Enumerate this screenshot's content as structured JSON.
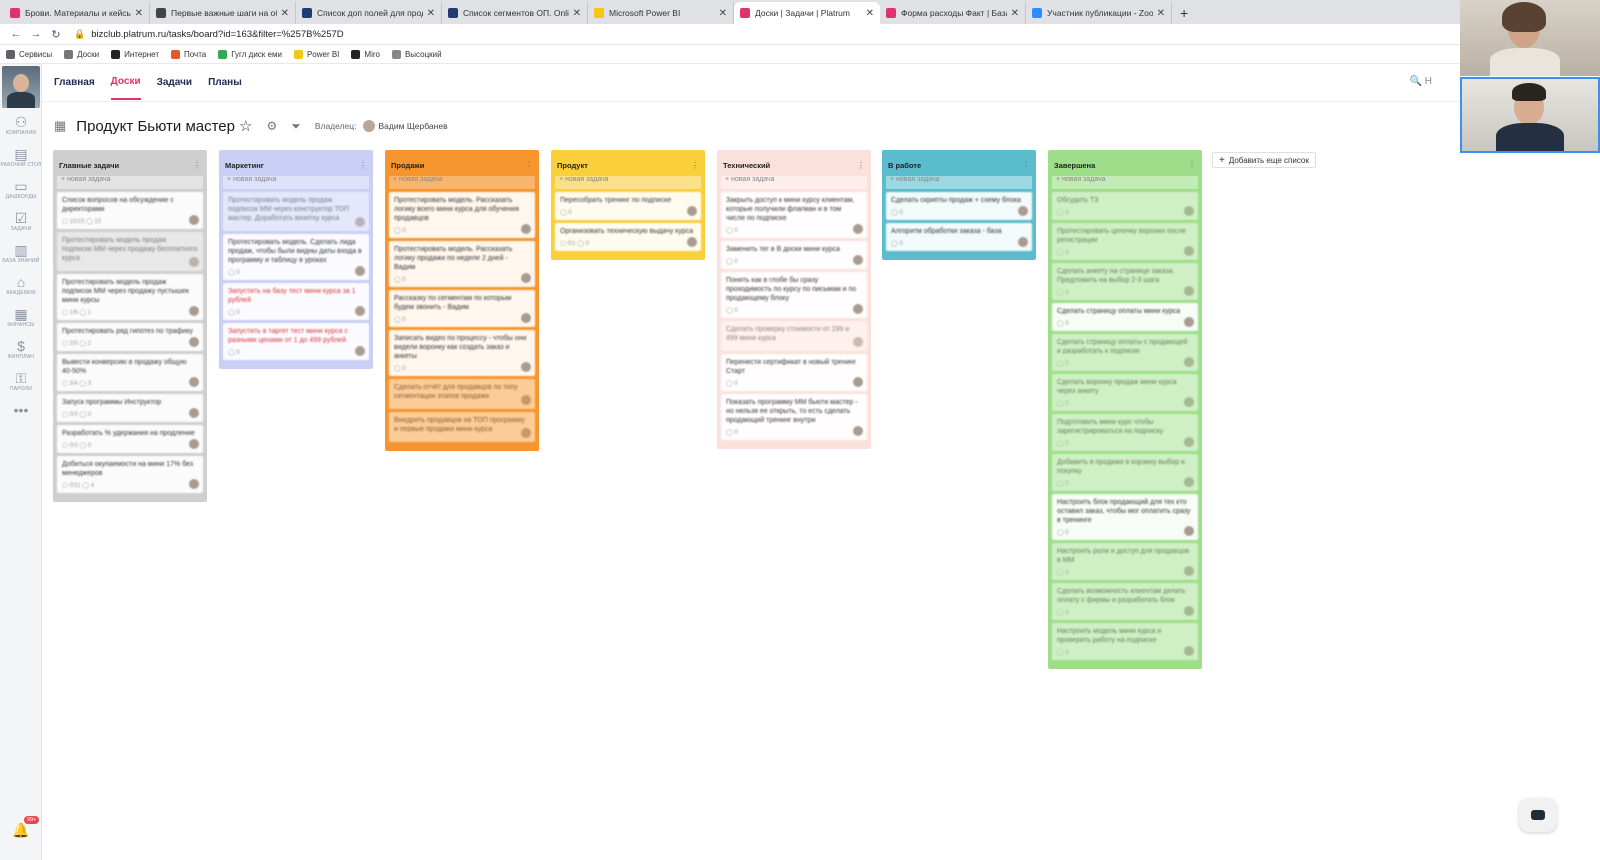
{
  "browser": {
    "tabs": [
      {
        "title": "Брови. Материалы и кейсы | ...",
        "color": "#e0336b",
        "active": false
      },
      {
        "title": "Первые важные шаги на обу...",
        "color": "#444444",
        "active": false
      },
      {
        "title": "Список доп полей для прод...",
        "color": "#1f3b70",
        "active": false
      },
      {
        "title": "Список сегментов ОП. Onlin...",
        "color": "#1f3b70",
        "active": false
      },
      {
        "title": "Microsoft Power BI",
        "color": "#f2c811",
        "active": false
      },
      {
        "title": "Доски | Задачи | Platrum",
        "color": "#e0336b",
        "active": true
      },
      {
        "title": "Форма расходы Факт | База...",
        "color": "#e0336b",
        "active": false
      },
      {
        "title": "Участник публикации - Zoom",
        "color": "#2d8cff",
        "active": false
      }
    ],
    "url": "bizclub.platrum.ru/tasks/board?id=163&filter=%257B%257D",
    "bookmarks": [
      {
        "label": "Сервисы",
        "color": "#5f6368"
      },
      {
        "label": "Доски",
        "color": "#777777"
      },
      {
        "label": "Интернет",
        "color": "#222222"
      },
      {
        "label": "Почта",
        "color": "#e8572b"
      },
      {
        "label": "Гугл диск еми",
        "color": "#34a853"
      },
      {
        "label": "Power BI",
        "color": "#f2c811"
      },
      {
        "label": "Miro",
        "color": "#222222"
      },
      {
        "label": "Высоцкий",
        "color": "#888888"
      }
    ]
  },
  "rail": {
    "items": [
      {
        "icon": "⚇",
        "label": "Компания"
      },
      {
        "icon": "▤",
        "label": "Рабочий стол"
      },
      {
        "icon": "▭",
        "label": "Дашборды"
      },
      {
        "icon": "☑",
        "label": "Задачи"
      },
      {
        "icon": "▥",
        "label": "База знаний"
      },
      {
        "icon": "⌂",
        "label": "Академия"
      },
      {
        "icon": "▦",
        "label": "Финансы"
      },
      {
        "icon": "$",
        "label": "Финплан"
      },
      {
        "icon": "⚿",
        "label": "Пароли"
      },
      {
        "icon": "•••",
        "label": ""
      }
    ],
    "notifications": "99+"
  },
  "nav": {
    "items": [
      "Главная",
      "Доски",
      "Задачи",
      "Планы"
    ],
    "active_index": 1,
    "search_hint": "Н"
  },
  "board": {
    "title": "Продукт Бьюти мастер",
    "owner_label": "Владелец:",
    "owner_name": "Вадим Щербанев",
    "add_list": "Добавить еще список",
    "new_task": "+ новая задача"
  },
  "columns": [
    {
      "title": "Главные задачи",
      "bg": "#cfcfcf",
      "newbg": "#e3e3e3",
      "cards": [
        {
          "text": "Список вопросов на обсуждение с директорами",
          "meta": "▢ 10/15  ◯ 10"
        },
        {
          "text": "Протестировать модель продаж подписки MM через продажу бесплатного курса",
          "meta": "",
          "faded": true
        },
        {
          "text": "Протестировать модель продаж подписок MM через продажу пустышек мини курсы",
          "meta": "▢ 1/6  ◯ 1"
        },
        {
          "text": "Протестировать ряд гипотез по трафику",
          "meta": "▢ 2/5  ◯ 2"
        },
        {
          "text": "Вывести конверсию в продажу общую 40-50%",
          "meta": "▢ 3/4  ◯ 3"
        },
        {
          "text": "Запуск программы Инструктор",
          "meta": "▢ 0/3  ◯ 0"
        },
        {
          "text": "Разработать % удержания на продление",
          "meta": "▢ 0/3  ◯ 0"
        },
        {
          "text": "Добиться окупаемости на мини 17% без менеджеров",
          "meta": "▢ 0/11  ◯ 4"
        }
      ]
    },
    {
      "title": "Маркетинг",
      "bg": "#c9cff5",
      "newbg": "#dde1fa",
      "cards": [
        {
          "text": "Протестировать модель продаж подписок MM через конструктор ТОП мастер. Доработать визитку курса",
          "meta": "",
          "faded": true
        },
        {
          "text": "Протестировать модель. Сделать лида продаж, чтобы были видны даты входа в программу и таблицу в уроках",
          "meta": "◯ 0"
        },
        {
          "text": "Запустить на базу тест мини курса за 1 рублей",
          "meta": "◯ 0",
          "red": true
        },
        {
          "text": "Запустить в таргет тест мини курса с разными ценами от 1 до 499 рублей",
          "meta": "◯ 0",
          "red": true
        }
      ]
    },
    {
      "title": "Продажи",
      "bg": "#f6952e",
      "newbg": "#f9b56e",
      "cards": [
        {
          "text": "Протестировать модель. Рассказать логику всего мини курса для обучения продавцов",
          "meta": "◯ 0"
        },
        {
          "text": "Протестировать модель. Рассказать логику продажи по неделе 2 дней - Вадим",
          "meta": "◯ 0"
        },
        {
          "text": "Рассказку по сегментам по которым будем звонить - Вадим",
          "meta": "◯ 0"
        },
        {
          "text": "Записать видео по процессу - чтобы они видели воронку как создать заказ и анкеты",
          "meta": "◯ 0"
        },
        {
          "text": "Сделать отчёт для продавцов по типу сегментации этапов продажи",
          "meta": "",
          "faded": true
        },
        {
          "text": "Внедрить продавцов на ТОП программу и первые продажи мини курса",
          "meta": "",
          "faded": true
        }
      ]
    },
    {
      "title": "Продукт",
      "bg": "#f9cf3a",
      "newbg": "#fbe08a",
      "cards": [
        {
          "text": "Пересобрать тренинг по подписке",
          "meta": "◯ 0"
        },
        {
          "text": "Организовать техническую выдачу курса",
          "meta": "▢ 0/1  ◯ 0"
        }
      ]
    },
    {
      "title": "Технический",
      "bg": "#fbe1dc",
      "newbg": "#fdeeeb",
      "cards": [
        {
          "text": "Закрыть доступ к мини курсу клиентам, которые получили флагман и в том числе по подписке",
          "meta": "◯ 0"
        },
        {
          "text": "Заменить тег в B доски мини курса",
          "meta": "◯ 0"
        },
        {
          "text": "Понять как в глобе бы сразу проходимость по курсу по письмам и по продающему блоку",
          "meta": "◯ 0"
        },
        {
          "text": "Сделать проверку стоимости от 299 и 499 мини курса",
          "meta": "",
          "faded": true
        },
        {
          "text": "Перенести сертификат в новый тренинг Старт",
          "meta": "◯ 0"
        },
        {
          "text": "Показать программу MM бьюти мастер - но нельзя ее открыть, то есть сделать продающий тренинг внутри",
          "meta": "◯ 0"
        }
      ]
    },
    {
      "title": "В работе",
      "bg": "#5bbccd",
      "newbg": "#9ad8e2",
      "cards": [
        {
          "text": "Сделать скрипты продаж + схему блока",
          "meta": "◯ 0"
        },
        {
          "text": "Алгоритм обработки заказа - база",
          "meta": "◯ 0"
        }
      ]
    },
    {
      "title": "Завершена",
      "bg": "#9ede8a",
      "newbg": "#c2ebb5",
      "cards": [
        {
          "text": "Обсудить ТЗ",
          "meta": "◯ 0",
          "faded": true
        },
        {
          "text": "Протестировать цепочку воронки после регистрации",
          "meta": "◯ 0",
          "faded": true
        },
        {
          "text": "Сделать анкету на странице заказа. Предложить на выбор 2-3 шага",
          "meta": "◯ 0",
          "faded": true
        },
        {
          "text": "Сделать страницу оплаты мини курса",
          "meta": "◯ 0"
        },
        {
          "text": "Сделать страницу оплаты с продающей и разработать к подписке",
          "meta": "◯ 0",
          "faded": true
        },
        {
          "text": "Сделать воронку продаж мини курса через анкету",
          "meta": "◯ 0",
          "faded": true
        },
        {
          "text": "Подготовить мини курс чтобы зарегистрироваться на подписку",
          "meta": "◯ 0",
          "faded": true
        },
        {
          "text": "Добавить в продажи в корзину выбор и покупку",
          "meta": "◯ 0",
          "faded": true
        },
        {
          "text": "Настроить блок продающий для тех кто оставил заказ, чтобы мог оплатить сразу в тренинге",
          "meta": "◯ 0"
        },
        {
          "text": "Настроить роли и доступ для продавцов в MM",
          "meta": "◯ 0",
          "faded": true
        },
        {
          "text": "Сделать возможность клиентам делать оплату с фирмы и разработать блок",
          "meta": "◯ 0",
          "faded": true
        },
        {
          "text": "Настроить модель мини курса и проверить работу на подписке",
          "meta": "◯ 0",
          "faded": true
        }
      ]
    }
  ]
}
